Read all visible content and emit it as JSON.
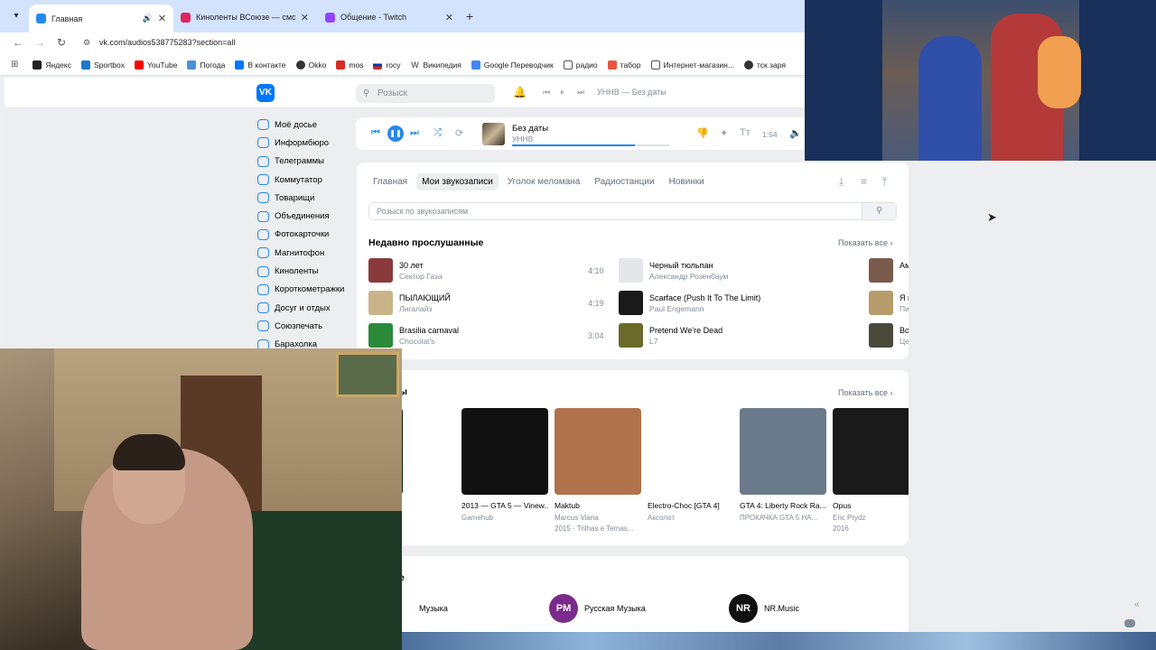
{
  "browser": {
    "tabs": [
      {
        "title": "Главная",
        "color": "#2688eb"
      },
      {
        "title": "Киноленты ВСоюзе — смотре",
        "color": "#e0245e"
      },
      {
        "title": "Общение - Twitch",
        "color": "#9146ff"
      }
    ],
    "url": "vk.com/audios538775283?section=all",
    "bookmarks": [
      {
        "label": "Яндекс",
        "color": "#222222"
      },
      {
        "label": "Sportbox",
        "color": "#1e78c8"
      },
      {
        "label": "YouTube",
        "color": "#ff0000"
      },
      {
        "label": "Погода",
        "color": "#4a90d9"
      },
      {
        "label": "В контакте",
        "color": "#0077ff"
      },
      {
        "label": "Okko",
        "color": "#333333"
      },
      {
        "label": "mos",
        "color": "#d62d20"
      },
      {
        "label": "rocy",
        "color": "#d62d20"
      },
      {
        "label": "Википедия",
        "color": "#666666"
      },
      {
        "label": "Google Переводчик",
        "color": "#4285f4"
      },
      {
        "label": "радио",
        "color": "#666666"
      },
      {
        "label": "табор",
        "color": "#e8543f"
      },
      {
        "label": "Интернет-магазин...",
        "color": "#666666"
      },
      {
        "label": "тск заря",
        "color": "#333333"
      }
    ]
  },
  "header": {
    "logo": "VK",
    "search_placeholder": "Розыск",
    "now_playing": "УННВ — Без даты"
  },
  "left_nav": [
    "Моё досье",
    "Информбюро",
    "Телеграммы",
    "Коммутатор",
    "Товарищи",
    "Объединения",
    "Фотокарточки",
    "Магнитофон",
    "Киноленты",
    "Короткометражки",
    "Досуг и отдых",
    "Союзпечать",
    "Барахолка"
  ],
  "player": {
    "title": "Без даты",
    "artist": "УННВ",
    "time": "1:54",
    "progress": 0.78
  },
  "audio": {
    "tabs": [
      "Главная",
      "Мои звукозаписи",
      "Уголок меломана",
      "Радиостанции",
      "Новинки"
    ],
    "active_tab": 1,
    "search_placeholder": "Розыск по звукозаписям",
    "recent_title": "Недавно прослушанные",
    "show_all": "Показать все",
    "recent": [
      {
        "title": "30 лет",
        "artist": "Сектор Газа",
        "duration": "4:10",
        "color": "#8a3a3a"
      },
      {
        "title": "Черный тюльпан",
        "artist": "Александр Розенбаум",
        "duration": "3:52",
        "color": "#e4e6ea"
      },
      {
        "title": "Ам",
        "artist": "",
        "duration": "",
        "color": "#7a5a4a"
      },
      {
        "title": "ПЫЛАЮЩИЙ",
        "artist": "Лигалайз",
        "duration": "4:19",
        "color": "#c9b48a"
      },
      {
        "title": "Scarface (Push It To The Limit)",
        "artist": "Paul Engemann",
        "duration": "3:04",
        "color": "#1a1a1a"
      },
      {
        "title": "Я п",
        "artist": "Пи",
        "duration": "",
        "color": "#b59c6a"
      },
      {
        "title": "Brasilia carnaval",
        "artist": "Chocolat's",
        "duration": "3:04",
        "color": "#2a8a3a"
      },
      {
        "title": "Pretend We're Dead",
        "artist": "L7",
        "duration": "3:55",
        "color": "#6a6a2a"
      },
      {
        "title": "Во",
        "artist": "Це",
        "duration": "",
        "color": "#4a4a3a"
      }
    ],
    "playlists_title": "ы",
    "playlists": [
      {
        "title": "eory",
        "sub1": "in",
        "sub2": "",
        "color": "#0c1a0c"
      },
      {
        "title": "2013 — GTA 5 — Vinew...",
        "sub1": "Gamehub",
        "sub2": "",
        "color": "#111111"
      },
      {
        "title": "Maktub",
        "sub1": "Marcus Viana",
        "sub2": "2015 · Trilhas e Temas...",
        "color": "#b0724a"
      },
      {
        "title": "Electro-Choc [GTA 4]",
        "sub1": "Аксолот",
        "sub2": "",
        "color": "#ffffff"
      },
      {
        "title": "GTA 4: Liberty Rock Ra...",
        "sub1": "ПРОКАЧКА GTA 5 НА...",
        "sub2": "",
        "color": "#6a7a8a"
      },
      {
        "title": "Opus",
        "sub1": "Eric Prydz",
        "sub2": "2016",
        "color": "#1a1a1a"
      }
    ],
    "curators_title": "е",
    "curators": [
      {
        "name": "Музыка",
        "avatar": "",
        "color": "#ffffff"
      },
      {
        "name": "Русская Музыка",
        "avatar": "PM",
        "color": "#7a2a8a"
      },
      {
        "name": "NR.Music",
        "avatar": "NR",
        "color": "#111111"
      }
    ]
  }
}
